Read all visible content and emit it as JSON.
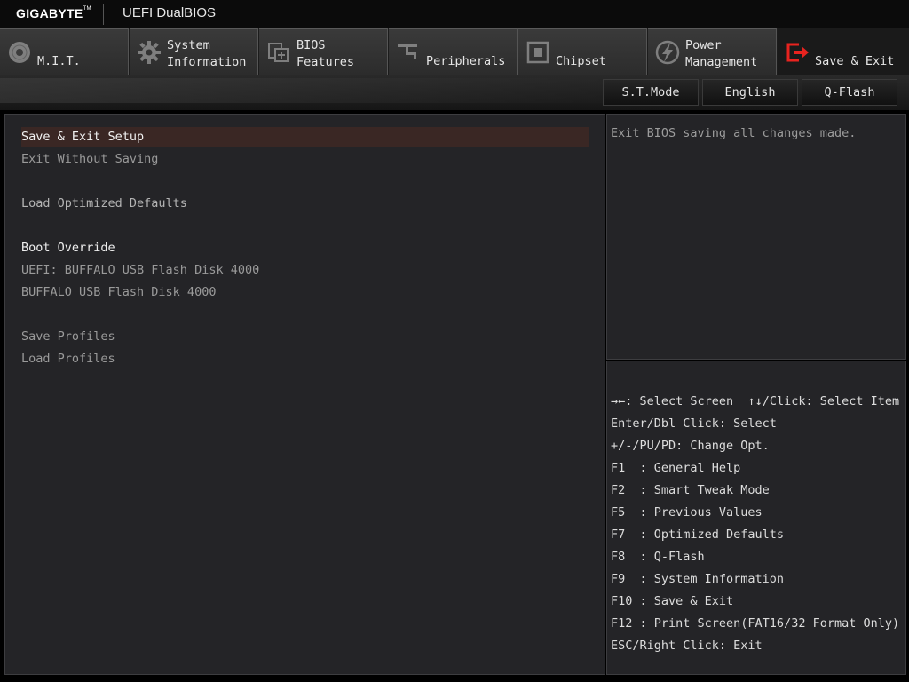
{
  "header": {
    "brand": "GIGABYTE",
    "brand_tm": "TM",
    "product": "UEFI DualBIOS"
  },
  "tabs": [
    {
      "line1": "M.I.T.",
      "line2": "",
      "icon": "disc-icon"
    },
    {
      "line1": "System",
      "line2": "Information",
      "icon": "gear-icon"
    },
    {
      "line1": "BIOS",
      "line2": "Features",
      "icon": "chip-plus-icon"
    },
    {
      "line1": "Peripherals",
      "line2": "",
      "icon": "plug-icon"
    },
    {
      "line1": "Chipset",
      "line2": "",
      "icon": "chipset-icon"
    },
    {
      "line1": "Power",
      "line2": "Management",
      "icon": "power-bolt-icon"
    },
    {
      "line1": "Save & Exit",
      "line2": "",
      "icon": "exit-door-icon",
      "active": true,
      "accent": "#e8231f"
    }
  ],
  "toolbar": {
    "stmode": "S.T.Mode",
    "language": "English",
    "qflash": "Q-Flash"
  },
  "menu": {
    "save_exit_setup": "Save & Exit Setup",
    "exit_without_saving": "Exit Without Saving",
    "load_optimized_defaults": "Load Optimized Defaults",
    "boot_override": "Boot Override",
    "boot_uefi_buffalo": "UEFI: BUFFALO USB Flash Disk 4000",
    "boot_buffalo": "BUFFALO USB Flash Disk 4000",
    "save_profiles": "Save Profiles",
    "load_profiles": "Load Profiles"
  },
  "help": {
    "text": "Exit BIOS saving all changes made."
  },
  "keys": {
    "select_screen": ": Select Screen",
    "select_item": "/Click: Select Item",
    "enter": "Enter/Dbl Click: Select",
    "change": "+/-/PU/PD: Change Opt.",
    "f1": "F1  : General Help",
    "f2": "F2  : Smart Tweak Mode",
    "f5": "F5  : Previous Values",
    "f7": "F7  : Optimized Defaults",
    "f8": "F8  : Q-Flash",
    "f9": "F9  : System Information",
    "f10": "F10 : Save & Exit",
    "f12": "F12 : Print Screen(FAT16/32 Format Only)",
    "esc": "ESC/Right Click: Exit"
  },
  "colors": {
    "accent": "#e8231f",
    "selected_row": "#3a2724",
    "panel": "#242427"
  }
}
